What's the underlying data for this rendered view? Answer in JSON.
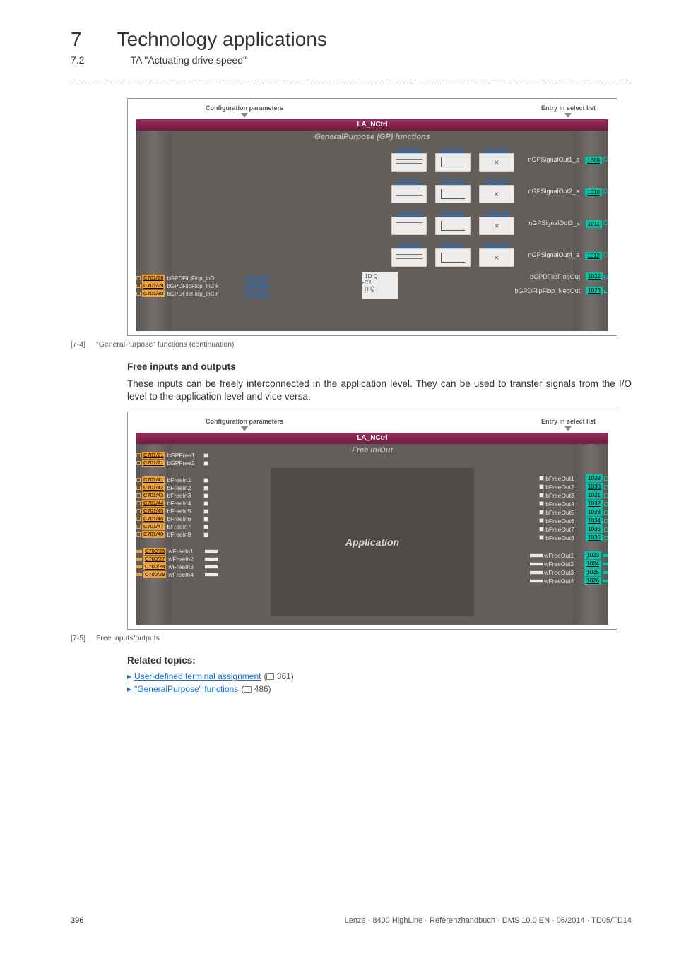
{
  "chapter": {
    "num": "7",
    "title": "Technology applications"
  },
  "section": {
    "num": "7.2",
    "title": "TA \"Actuating drive speed\""
  },
  "diagram1": {
    "cfg_label": "Configuration parameters",
    "entry_label": "Entry in select list",
    "title": "LA_NCtrl",
    "subtitle": "GeneralPurpose (GP) functions",
    "gp_rows": [
      {
        "p1": "C00410/1",
        "p2": "C00413/1",
        "p3": "C00413/2",
        "out": "nGPSignalOut1_a",
        "port": "1009"
      },
      {
        "p1": "C00410/2",
        "p2": "C00413/3",
        "p3": "C00413/4",
        "out": "nGPSignalOut2_a",
        "port": "1010"
      },
      {
        "p1": "C00410/3",
        "p2": "C00413/5",
        "p3": "C00413/6",
        "out": "nGPSignalOut3_a",
        "port": "1011"
      },
      {
        "p1": "C00410/4",
        "p2": "C00413/7",
        "p3": "C00413/8",
        "out": "nGPSignalOut4_a",
        "port": "1012"
      }
    ],
    "ff_ins": [
      {
        "port": "C701/28",
        "label": "bGPDFlipFlop_InD",
        "param": "C00833/4"
      },
      {
        "port": "C701/29",
        "label": "bGPDFlipFlop_InClk",
        "param": "C00833/5"
      },
      {
        "port": "C701/30",
        "label": "bGPDFlipFlop_InClr",
        "param": "C00833/6"
      }
    ],
    "ff_block": {
      "l1": "1D  Q",
      "l2": "C1",
      "l3": "R    Q̄"
    },
    "ff_outs": [
      {
        "label": "bGPDFlipFlopOut",
        "port": "1022"
      },
      {
        "label": "bGPDFlipFlop_NegOut",
        "port": "1023"
      }
    ],
    "caption_tag": "[7-4]",
    "caption_txt": "\"GeneralPurpose\" functions (continuation)"
  },
  "free_section": {
    "heading": "Free inputs and outputs",
    "body": "These inputs can be freely interconnected in the application level. They can be used to transfer signals from the I/O level to the application level and vice versa."
  },
  "diagram2": {
    "cfg_label": "Configuration parameters",
    "entry_label": "Entry in select list",
    "title": "LA_NCtrl",
    "subtitle": "Free In/Out",
    "app_label": "Application",
    "gp_free": [
      {
        "port": "C701/21",
        "label": "bGPFree1"
      },
      {
        "port": "C701/21",
        "label": "bGPFree2"
      }
    ],
    "b_in": [
      {
        "port": "C701/41",
        "label": "bFreeIn1"
      },
      {
        "port": "C701/42",
        "label": "bFreeIn2"
      },
      {
        "port": "C701/43",
        "label": "bFreeIn3"
      },
      {
        "port": "C701/44",
        "label": "bFreeIn4"
      },
      {
        "port": "C701/45",
        "label": "bFreeIn5"
      },
      {
        "port": "C701/46",
        "label": "bFreeIn6"
      },
      {
        "port": "C701/47",
        "label": "bFreeIn7"
      },
      {
        "port": "C701/48",
        "label": "bFreeIn8"
      }
    ],
    "w_in": [
      {
        "port": "C700/26",
        "label": "wFreeIn1"
      },
      {
        "port": "C700/27",
        "label": "wFreeIn2"
      },
      {
        "port": "C700/28",
        "label": "wFreeIn3"
      },
      {
        "port": "C700/29",
        "label": "wFreeIn4"
      }
    ],
    "b_out": [
      {
        "label": "bFreeOut1",
        "port": "1029"
      },
      {
        "label": "bFreeOut2",
        "port": "1030"
      },
      {
        "label": "bFreeOut3",
        "port": "1031"
      },
      {
        "label": "bFreeOut4",
        "port": "1032"
      },
      {
        "label": "bFreeOut5",
        "port": "1033"
      },
      {
        "label": "bFreeOut6",
        "port": "1034"
      },
      {
        "label": "bFreeOut7",
        "port": "1035"
      },
      {
        "label": "bFreeOut8",
        "port": "1036"
      }
    ],
    "w_out": [
      {
        "label": "wFreeOut1",
        "port": "1023"
      },
      {
        "label": "wFreeOut2",
        "port": "1024"
      },
      {
        "label": "wFreeOut3",
        "port": "1025"
      },
      {
        "label": "wFreeOut4",
        "port": "1026"
      }
    ],
    "caption_tag": "[7-5]",
    "caption_txt": "Free inputs/outputs"
  },
  "related": {
    "heading": "Related topics:",
    "items": [
      {
        "text": "User-defined terminal assignment",
        "page": "361"
      },
      {
        "text": "\"GeneralPurpose\" functions",
        "page": "486"
      }
    ]
  },
  "footer": {
    "page": "396",
    "doc": "Lenze · 8400 HighLine · Referenzhandbuch · DMS 10.0 EN · 06/2014 · TD05/TD14"
  }
}
